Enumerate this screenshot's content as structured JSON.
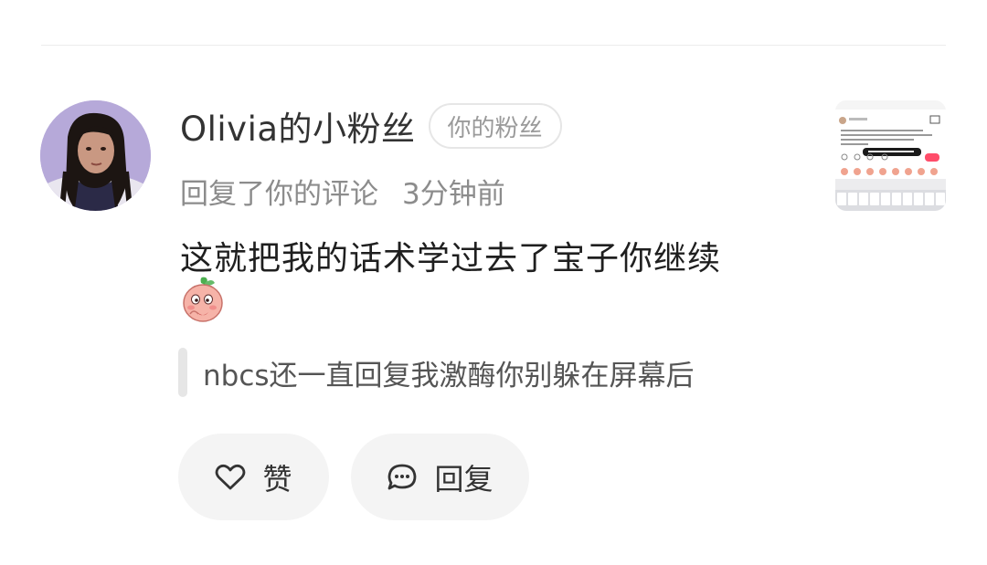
{
  "notification": {
    "username": "Olivia的小粉丝",
    "badge": "你的粉丝",
    "action": "回复了你的评论",
    "time": "3分钟前",
    "comment": "这就把我的话术学过去了宝子你继续",
    "sticker_icon": "peach-emoji-sticker",
    "quoted_text": "nbcs还一直回复我激酶你别躲在屏幕后"
  },
  "actions": {
    "like_label": "赞",
    "reply_label": "回复"
  },
  "colors": {
    "badge_border": "#e6e6e6",
    "secondary_text": "#8c8c8c",
    "button_bg": "#f4f4f4"
  }
}
